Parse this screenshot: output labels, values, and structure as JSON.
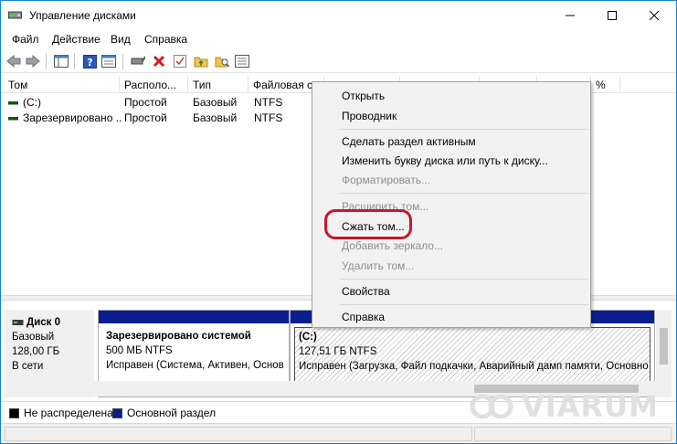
{
  "window": {
    "title": "Управление дисками"
  },
  "icons": {
    "app": "disk-management-icon",
    "minimize": "minimize-icon",
    "maximize": "maximize-icon",
    "close": "close-icon",
    "toolbar": [
      "back-arrow-icon",
      "forward-arrow-icon",
      "show-hide-console-tree-icon",
      "help-icon",
      "properties-icon",
      "connect-drive-icon",
      "delete-icon",
      "check-icon",
      "up-folder-icon",
      "search-folder-icon",
      "view-icon"
    ]
  },
  "menubar": [
    "Файл",
    "Действие",
    "Вид",
    "Справка"
  ],
  "table": {
    "columns": [
      "Том",
      "Располо...",
      "Тип",
      "Файловая с",
      "",
      "",
      "",
      "",
      "%"
    ],
    "rows": [
      {
        "volume": "(C:)",
        "layout": "Простой",
        "type": "Базовый",
        "fs": "NTFS"
      },
      {
        "volume": "Зарезервировано ...",
        "layout": "Простой",
        "type": "Базовый",
        "fs": "NTFS"
      }
    ]
  },
  "disk": {
    "name": "Диск 0",
    "type": "Базовый",
    "size": "128,00 ГБ",
    "status": "В сети",
    "partitions": [
      {
        "title": "Зарезервировано системой",
        "size": "500 МБ NTFS",
        "status": "Исправен (Система, Активен, Основ"
      },
      {
        "title": "(C:)",
        "size": "127,51 ГБ NTFS",
        "status": "Исправен (Загрузка, Файл подкачки, Аварийный дамп памяти, Основно"
      }
    ]
  },
  "legend": [
    {
      "label": "Не распределена",
      "color": "#000000"
    },
    {
      "label": "Основной раздел",
      "color": "#0a1e8f"
    }
  ],
  "context_menu": {
    "items": [
      {
        "label": "Открыть",
        "enabled": true
      },
      {
        "label": "Проводник",
        "enabled": true
      },
      {
        "label": "Сделать раздел активным",
        "enabled": true
      },
      {
        "label": "Изменить букву диска или путь к диску...",
        "enabled": true
      },
      {
        "label": "Форматировать...",
        "enabled": false
      },
      {
        "label": "Расширить том...",
        "enabled": false
      },
      {
        "label": "Сжать том...",
        "enabled": true
      },
      {
        "label": "Добавить зеркало...",
        "enabled": false
      },
      {
        "label": "Удалить том...",
        "enabled": false
      },
      {
        "label": "Свойства",
        "enabled": true
      },
      {
        "label": "Справка",
        "enabled": true
      }
    ],
    "highlighted": "Сжать том..."
  },
  "watermark": "VIARUM",
  "colors": {
    "accent": "#1883d7",
    "primary_partition": "#0a1e8f",
    "highlight_ring": "#c8182a"
  }
}
